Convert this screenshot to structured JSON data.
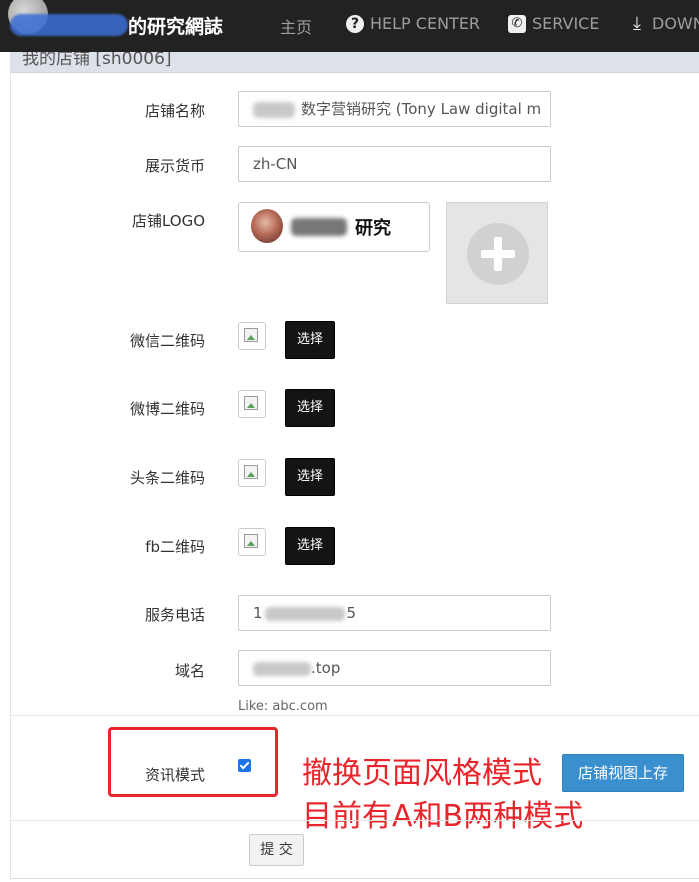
{
  "navbar": {
    "brand_suffix": "的研究網誌",
    "items": [
      {
        "label": "主页",
        "icon": ""
      },
      {
        "label": "HELP CENTER",
        "icon": "question-circle-icon"
      },
      {
        "label": "SERVICE",
        "icon": "phone-icon"
      },
      {
        "label": "DOWN",
        "icon": "download-icon"
      }
    ]
  },
  "panel": {
    "heading": "我的店铺 [sh0006]"
  },
  "form": {
    "shop_name": {
      "label": "店铺名称",
      "value": "数字营销研究 (Tony Law digital m"
    },
    "currency": {
      "label": "展示货币",
      "value": "zh-CN"
    },
    "logo": {
      "label": "店铺LOGO",
      "text": "研究"
    },
    "qr_wechat": {
      "label": "微信二维码",
      "button": "选择"
    },
    "qr_weibo": {
      "label": "微博二维码",
      "button": "选择"
    },
    "qr_toutiao": {
      "label": "头条二维码",
      "button": "选择"
    },
    "qr_fb": {
      "label": "fb二维码",
      "button": "选择"
    },
    "phone": {
      "label": "服务电话",
      "value_prefix": "1",
      "value_suffix": "5"
    },
    "domain": {
      "label": "域名",
      "value_suffix": ".top",
      "hint": "Like: abc.com"
    },
    "info_mode": {
      "label": "资讯模式",
      "checked": true
    },
    "save_view_button": "店铺视图上存",
    "submit_button": "提 交"
  },
  "annotation": {
    "line1": "撤换页面风格模式",
    "line2": "目前有A和B两种模式",
    "color": "#e8252b"
  }
}
